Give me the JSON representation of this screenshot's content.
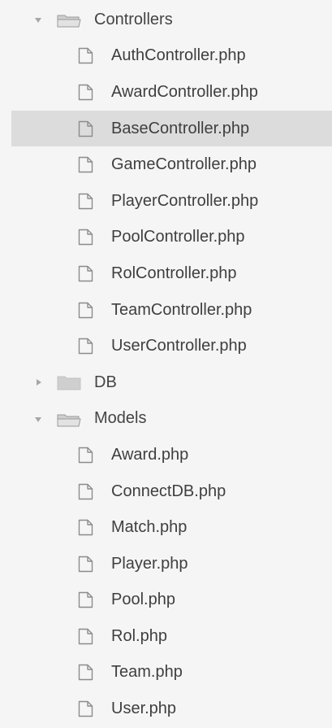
{
  "tree": {
    "controllers": {
      "label": "Controllers",
      "expanded": true,
      "files": [
        "AuthController.php",
        "AwardController.php",
        "BaseController.php",
        "GameController.php",
        "PlayerController.php",
        "PoolController.php",
        "RolController.php",
        "TeamController.php",
        "UserController.php"
      ],
      "selected": "BaseController.php"
    },
    "db": {
      "label": "DB",
      "expanded": false
    },
    "models": {
      "label": "Models",
      "expanded": true,
      "files": [
        "Award.php",
        "ConnectDB.php",
        "Match.php",
        "Player.php",
        "Pool.php",
        "Rol.php",
        "Team.php",
        "User.php"
      ]
    }
  },
  "colors": {
    "background": "#f5f5f5",
    "selected_row": "#dcdcdc",
    "icon": "#9a9a9a",
    "folder_fill": "#cfcfcf",
    "text": "#3f3f3f"
  }
}
